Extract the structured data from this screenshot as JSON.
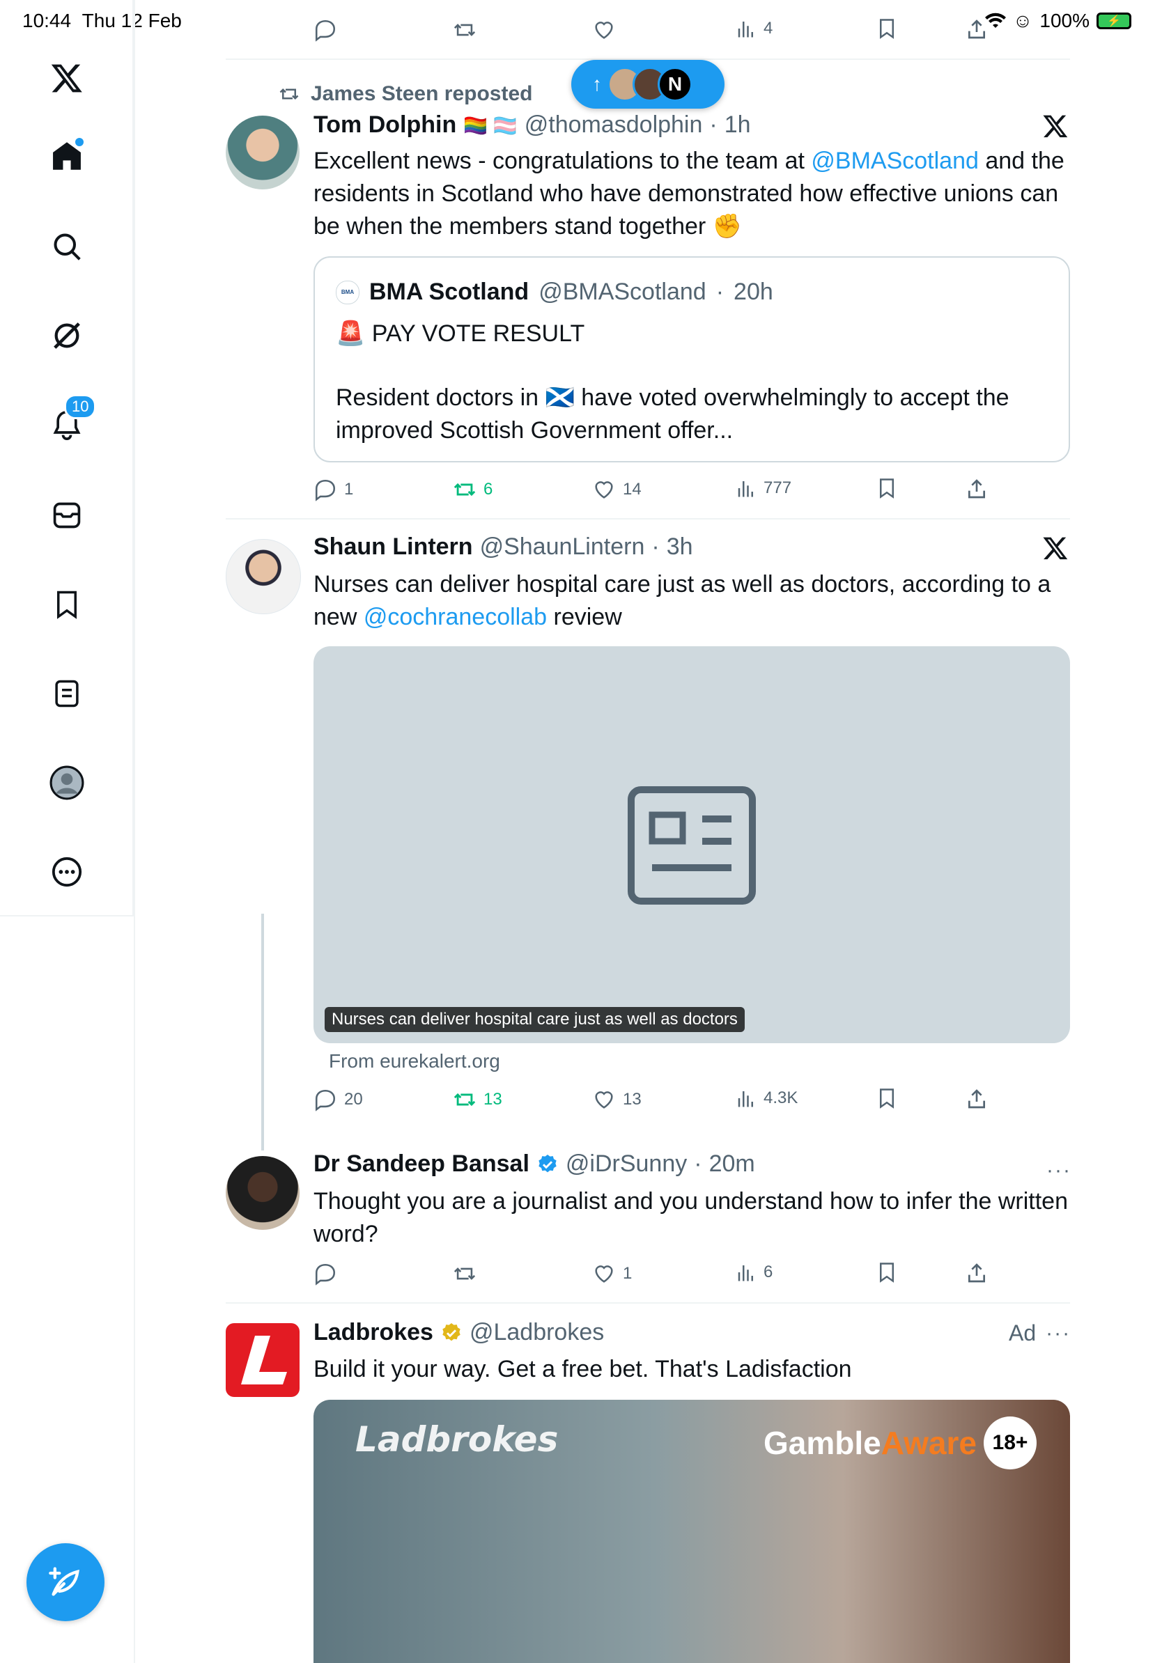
{
  "status_bar": {
    "time": "10:44",
    "date": "Thu 12 Feb",
    "battery": "100%"
  },
  "sidebar": {
    "notifications_badge": "10",
    "items": [
      "home-icon",
      "search-icon",
      "grok-icon",
      "notifications-icon",
      "messages-icon",
      "bookmarks-icon",
      "lists-icon",
      "profile-icon",
      "more-icon"
    ]
  },
  "top_actions": {
    "views": "4"
  },
  "new_posts_pill": {
    "arrow": "↑"
  },
  "post1": {
    "repost_label": "James Steen reposted",
    "author": "Tom Dolphin",
    "flags": "🏳️‍🌈 🏳️‍⚧️",
    "handle": "@thomasdolphin",
    "time": "1h",
    "text_a": "Excellent news - congratulations to the team at ",
    "mention": "@BMAScotland",
    "text_b": " and the residents in Scotland who have demonstrated how effective unions can be when the members stand together ✊",
    "quote": {
      "author": "BMA Scotland",
      "handle": "@BMAScotland",
      "time": "20h",
      "line1": "🚨 PAY VOTE RESULT",
      "line2": "Resident doctors in 🏴󠁧󠁢󠁳󠁣󠁴󠁿 have voted overwhelmingly to accept the improved Scottish Government offer..."
    },
    "replies": "1",
    "reposts": "6",
    "likes": "14",
    "views": "777"
  },
  "post2": {
    "author": "Shaun Lintern",
    "handle": "@ShaunLintern",
    "time": "3h",
    "text_a": "Nurses can deliver hospital care just as well as doctors, according to a new ",
    "mention": "@cochranecollab",
    "text_b": " review",
    "media_caption": "Nurses can deliver hospital care just as well as doctors",
    "source": "From eurekalert.org",
    "replies": "20",
    "reposts": "13",
    "likes": "13",
    "views": "4.3K"
  },
  "post3": {
    "author": "Dr Sandeep Bansal",
    "handle": "@iDrSunny",
    "time": "20m",
    "text": "Thought you are a journalist and you understand how to infer the written word?",
    "likes": "1",
    "views": "6"
  },
  "ad": {
    "author": "Ladbrokes",
    "handle": "@Ladbrokes",
    "ad_label": "Ad",
    "text": "Build it your way. Get a free bet. That's Ladisfaction",
    "brand_overlay": "Ladbrokes",
    "gamble": "Gamble",
    "aware": "Aware",
    "age": "18+"
  },
  "colors": {
    "accent": "#1d9bf0",
    "repost_green": "#00ba7c",
    "ladbrokes_red": "#e31b23",
    "muted": "#536471"
  }
}
